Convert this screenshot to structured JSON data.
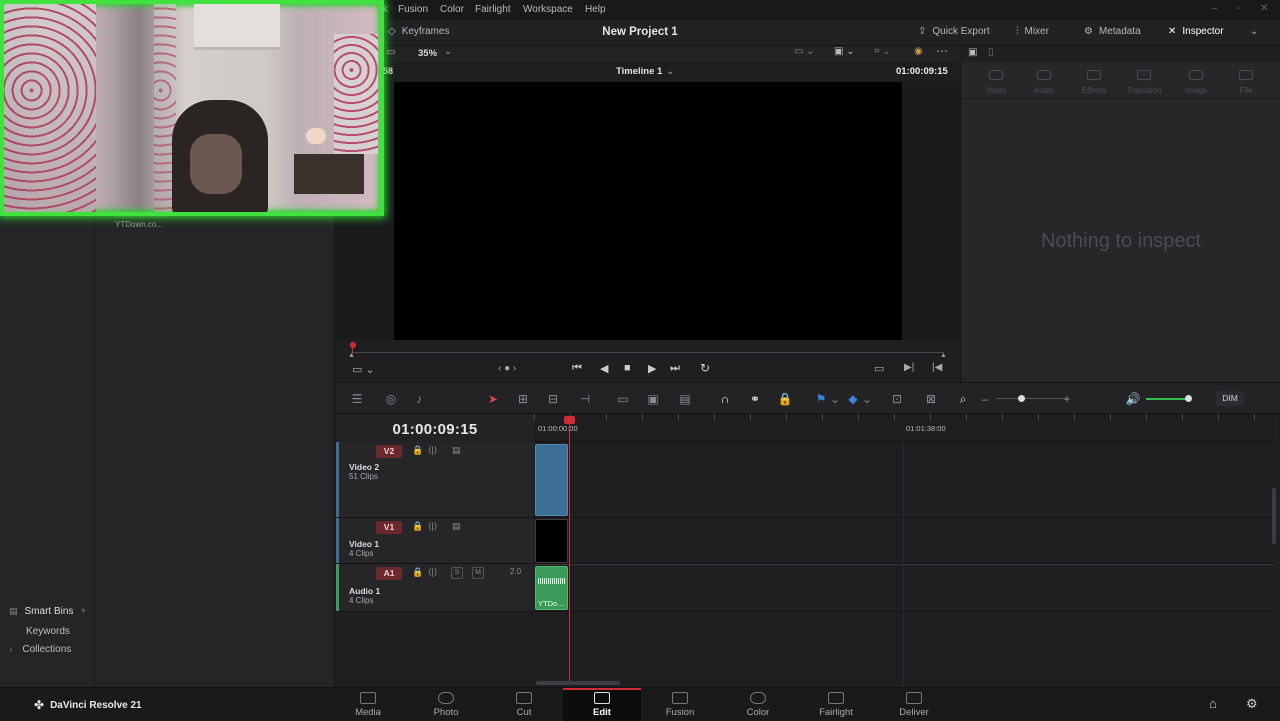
{
  "menu": {
    "items": [
      "ck",
      "Fusion",
      "Color",
      "Fairlight",
      "Workspace",
      "Help"
    ]
  },
  "toolbar": {
    "keyframes": "Keyframes",
    "project_title": "New Project 1",
    "quick_export": "Quick Export",
    "mixer": "Mixer",
    "metadata": "Metadata",
    "inspector": "Inspector"
  },
  "viewer": {
    "zoom": "35%",
    "left_timecode_fragment": ":58",
    "timeline_name": "Timeline 1",
    "timecode": "01:00:09:15"
  },
  "media": {
    "clip_label": "YTDown.co..."
  },
  "bins": {
    "smart_bins": "Smart Bins",
    "keywords": "Keywords",
    "collections": "Collections"
  },
  "inspector_panel": {
    "tabs": [
      "Video",
      "Audio",
      "Effects",
      "Transition",
      "Image",
      "File"
    ],
    "empty_message": "Nothing to inspect"
  },
  "edit_toolbar": {
    "dim": "DIM",
    "volume_level": 0.8
  },
  "timeline": {
    "timecode": "01:00:09:15",
    "ruler_start": "01:00:00:00",
    "ruler_mark": "01:01:38:00",
    "tracks": [
      {
        "tag": "V2",
        "name": "Video 2",
        "clips": "51 Clips"
      },
      {
        "tag": "V1",
        "name": "Video 1",
        "clips": "4 Clips"
      },
      {
        "tag": "A1",
        "name": "Audio 1",
        "clips": "4 Clips",
        "level": "2.0",
        "solo": "S",
        "mute": "M"
      }
    ],
    "audio_clip_label": "YTDo..."
  },
  "pages": {
    "app_name": "DaVinci Resolve 21",
    "items": [
      "Media",
      "Photo",
      "Cut",
      "Edit",
      "Fusion",
      "Color",
      "Fairlight",
      "Deliver"
    ],
    "active": "Edit"
  },
  "colors": {
    "accent_red": "#d12a35",
    "audio_green": "#3a9a5a",
    "video_blue": "#3d6f94",
    "webcam_border": "#3fe23f"
  }
}
